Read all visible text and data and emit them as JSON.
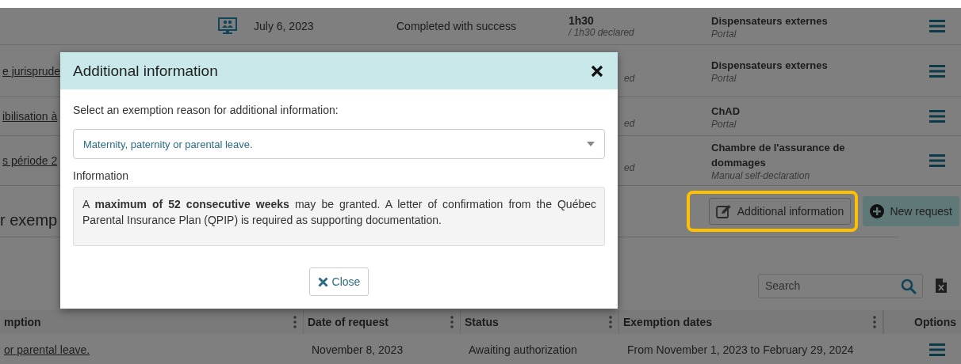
{
  "activities": [
    {
      "date": "July 6, 2023",
      "status": "Completed with success",
      "duration": "1h30",
      "declared": "/ 1h30 declared",
      "provider": "Dispensateurs externes",
      "channel": "Portal"
    },
    {
      "title": "e jurisprude",
      "declared": "ed",
      "provider": "Dispensateurs externes",
      "channel": "Portal"
    },
    {
      "title": "ibilisation à",
      "declared": "ed",
      "provider": "ChAD",
      "channel": "Portal"
    },
    {
      "title": "s période 2",
      "declared": "ed",
      "provider": "Chambre de l'assurance de dommages",
      "channel": "Manual self-declaration"
    }
  ],
  "section_title": "r exemp",
  "actions": [
    {
      "label": "Additional information",
      "kind": "edit",
      "highlighted": true
    },
    {
      "label": "New request",
      "kind": "add",
      "highlighted": false
    }
  ],
  "search": {
    "placeholder": "Search"
  },
  "exemptions_table": {
    "columns": [
      "mption",
      "Date of request",
      "Status",
      "Exemption dates",
      "Options"
    ],
    "rows": [
      {
        "cells": [
          "or parental leave.",
          "November 8, 2023",
          "Awaiting authorization",
          "From November 1, 2023 to February 29, 2024"
        ]
      }
    ]
  },
  "dialog": {
    "title": "Additional information",
    "prompt": "Select an exemption reason for additional information:",
    "reason": "Maternity, paternity or parental leave.",
    "info_label": "Information",
    "info_text": "A **maximum of 52 consecutive weeks** may be granted. A letter of confirmation from the Québec Parental Insurance Plan (QPIP) is required as supporting documentation.",
    "close_label": "Close"
  }
}
